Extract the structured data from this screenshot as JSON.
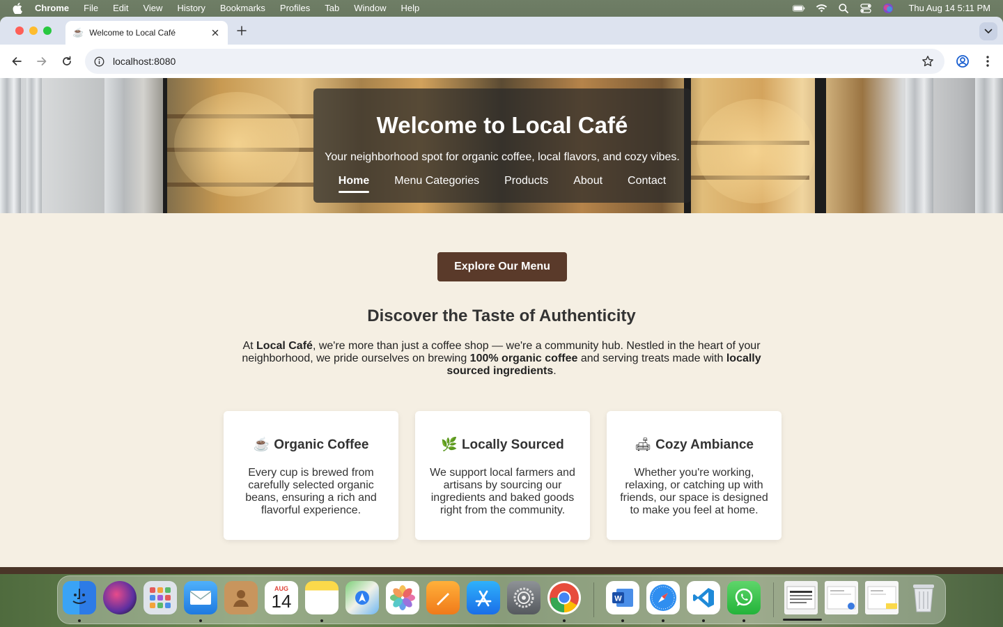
{
  "menubar": {
    "items": [
      "Chrome",
      "File",
      "Edit",
      "View",
      "History",
      "Bookmarks",
      "Profiles",
      "Tab",
      "Window",
      "Help"
    ],
    "clock": "Thu Aug 14  5:11 PM"
  },
  "browser": {
    "tab_title": "Welcome to Local Café",
    "tab_favicon": "☕",
    "url": "localhost:8080"
  },
  "hero": {
    "title": "Welcome to Local Café",
    "subtitle": "Your neighborhood spot for organic coffee, local flavors, and cozy vibes.",
    "nav": [
      "Home",
      "Menu Categories",
      "Products",
      "About",
      "Contact"
    ],
    "active_nav": "Home"
  },
  "cta_label": "Explore Our Menu",
  "section_title": "Discover the Taste of Authenticity",
  "intro": {
    "p1": "At ",
    "b1": "Local Café",
    "p2": ", we're more than just a coffee shop — we're a community hub. Nestled in the heart of your neighborhood, we pride ourselves on brewing ",
    "b2": "100% organic coffee",
    "p3": " and serving treats made with ",
    "b3": "locally sourced ingredients",
    "p4": "."
  },
  "cards": [
    {
      "emoji": "☕",
      "title": "Organic Coffee",
      "text": "Every cup is brewed from carefully selected organic beans, ensuring a rich and flavorful experience."
    },
    {
      "emoji": "🌿",
      "title": "Locally Sourced",
      "text": "We support local farmers and artisans by sourcing our ingredients and baked goods right from the community."
    },
    {
      "emoji": "🛋",
      "title": "Cozy Ambiance",
      "text": "Whether you're working, relaxing, or catching up with friends, our space is designed to make you feel at home."
    }
  ],
  "dock": {
    "calendar_month": "AUG",
    "calendar_day": "14",
    "icons": [
      "finder-icon",
      "siri-icon",
      "launchpad-icon",
      "mail-icon",
      "contacts-icon",
      "calendar-icon",
      "notes-icon",
      "maps-icon",
      "photos-icon",
      "pages-icon",
      "app-store-icon",
      "system-settings-icon",
      "chrome-icon",
      "word-icon",
      "safari-icon",
      "vscode-icon",
      "whatsapp-icon",
      "preview-window-icon",
      "document-window-icon",
      "notes-window-icon",
      "trash-icon"
    ]
  },
  "colors": {
    "page_bg": "#f5efe3",
    "cta_bg": "#5a3a2a",
    "hero_panel": "rgba(40,40,40,.72)"
  }
}
